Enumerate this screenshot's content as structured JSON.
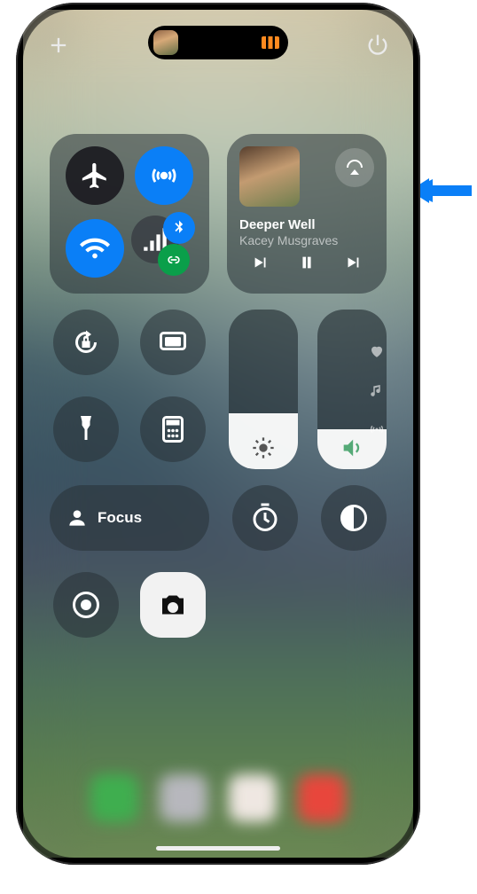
{
  "phone": {
    "now_playing_thumb": true
  },
  "top": {
    "add_icon": "plus",
    "power_icon": "power"
  },
  "connectivity": {
    "airplane_on": false,
    "airdrop_on": true,
    "wifi_on": true,
    "cellular_label": "signal",
    "bluetooth_on": true,
    "hotspot_on": true
  },
  "media": {
    "title": "Deeper Well",
    "artist": "Kacey Musgraves",
    "state": "paused"
  },
  "sliders": {
    "brightness_pct": 35,
    "volume_pct": 25
  },
  "focus": {
    "label": "Focus"
  },
  "side_nav": {
    "items": [
      "heart",
      "music",
      "radio"
    ]
  },
  "controls": [
    "orientation-lock",
    "screen-mirroring",
    "flashlight",
    "calculator",
    "timer",
    "dark-mode",
    "screen-record",
    "camera"
  ],
  "annotation": {
    "arrow_color": "#0a7ff7"
  }
}
